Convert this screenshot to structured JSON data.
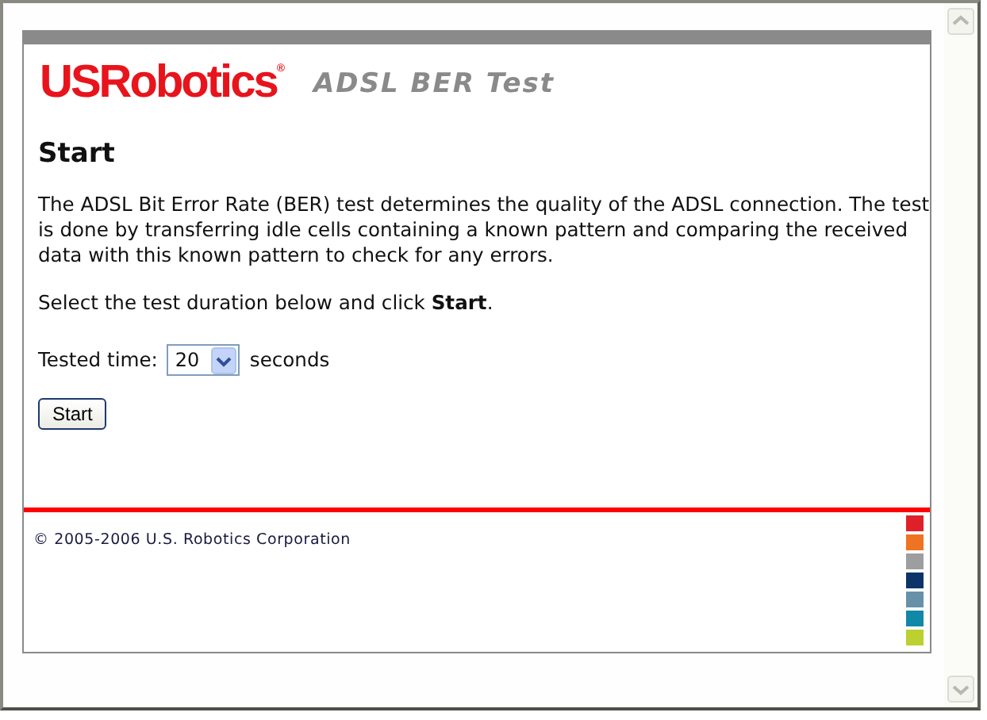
{
  "header": {
    "logo": "USRobotics",
    "logo_mark": "®",
    "title": "ADSL BER Test"
  },
  "heading": "Start",
  "description": "The ADSL Bit Error Rate (BER) test determines the quality of the ADSL connection. The test is done by transferring idle cells containing a known pattern and comparing the received data with this known pattern to check for any errors.",
  "instruction": "Select the test duration below and click **Start**.",
  "duration": {
    "label": "Tested time:",
    "value": "20",
    "unit": "seconds"
  },
  "button": "Start",
  "footer": {
    "copyright": "© 2005-2006 U.S. Robotics Corporation",
    "color_squares": [
      {
        "color": "#e02028"
      },
      {
        "color": "#ee7322"
      },
      {
        "color": "#9c9ea0"
      },
      {
        "color": "#0c3468"
      },
      {
        "color": "#6890a8"
      },
      {
        "color": "#1088a8"
      },
      {
        "color": "#bcd030"
      }
    ]
  }
}
